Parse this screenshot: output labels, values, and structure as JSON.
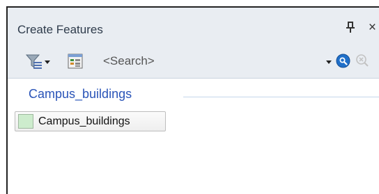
{
  "window": {
    "title": "Create Features",
    "pin_glyph": "ᵽ",
    "close_glyph": "×"
  },
  "toolbar": {
    "filter_icon": "filter-icon",
    "organize_icon": "organize-templates-icon",
    "search_placeholder": "<Search>",
    "search_icon": "search-icon",
    "clear_icon": "clear-search-icon"
  },
  "groups": [
    {
      "label": "Campus_buildings",
      "templates": [
        {
          "label": "Campus_buildings",
          "swatch_color": "#cdeccd"
        }
      ]
    }
  ],
  "colors": {
    "header_bg": "#e9edf2",
    "group_label": "#2a54b8",
    "search_icon_blue": "#1f6fc9"
  }
}
